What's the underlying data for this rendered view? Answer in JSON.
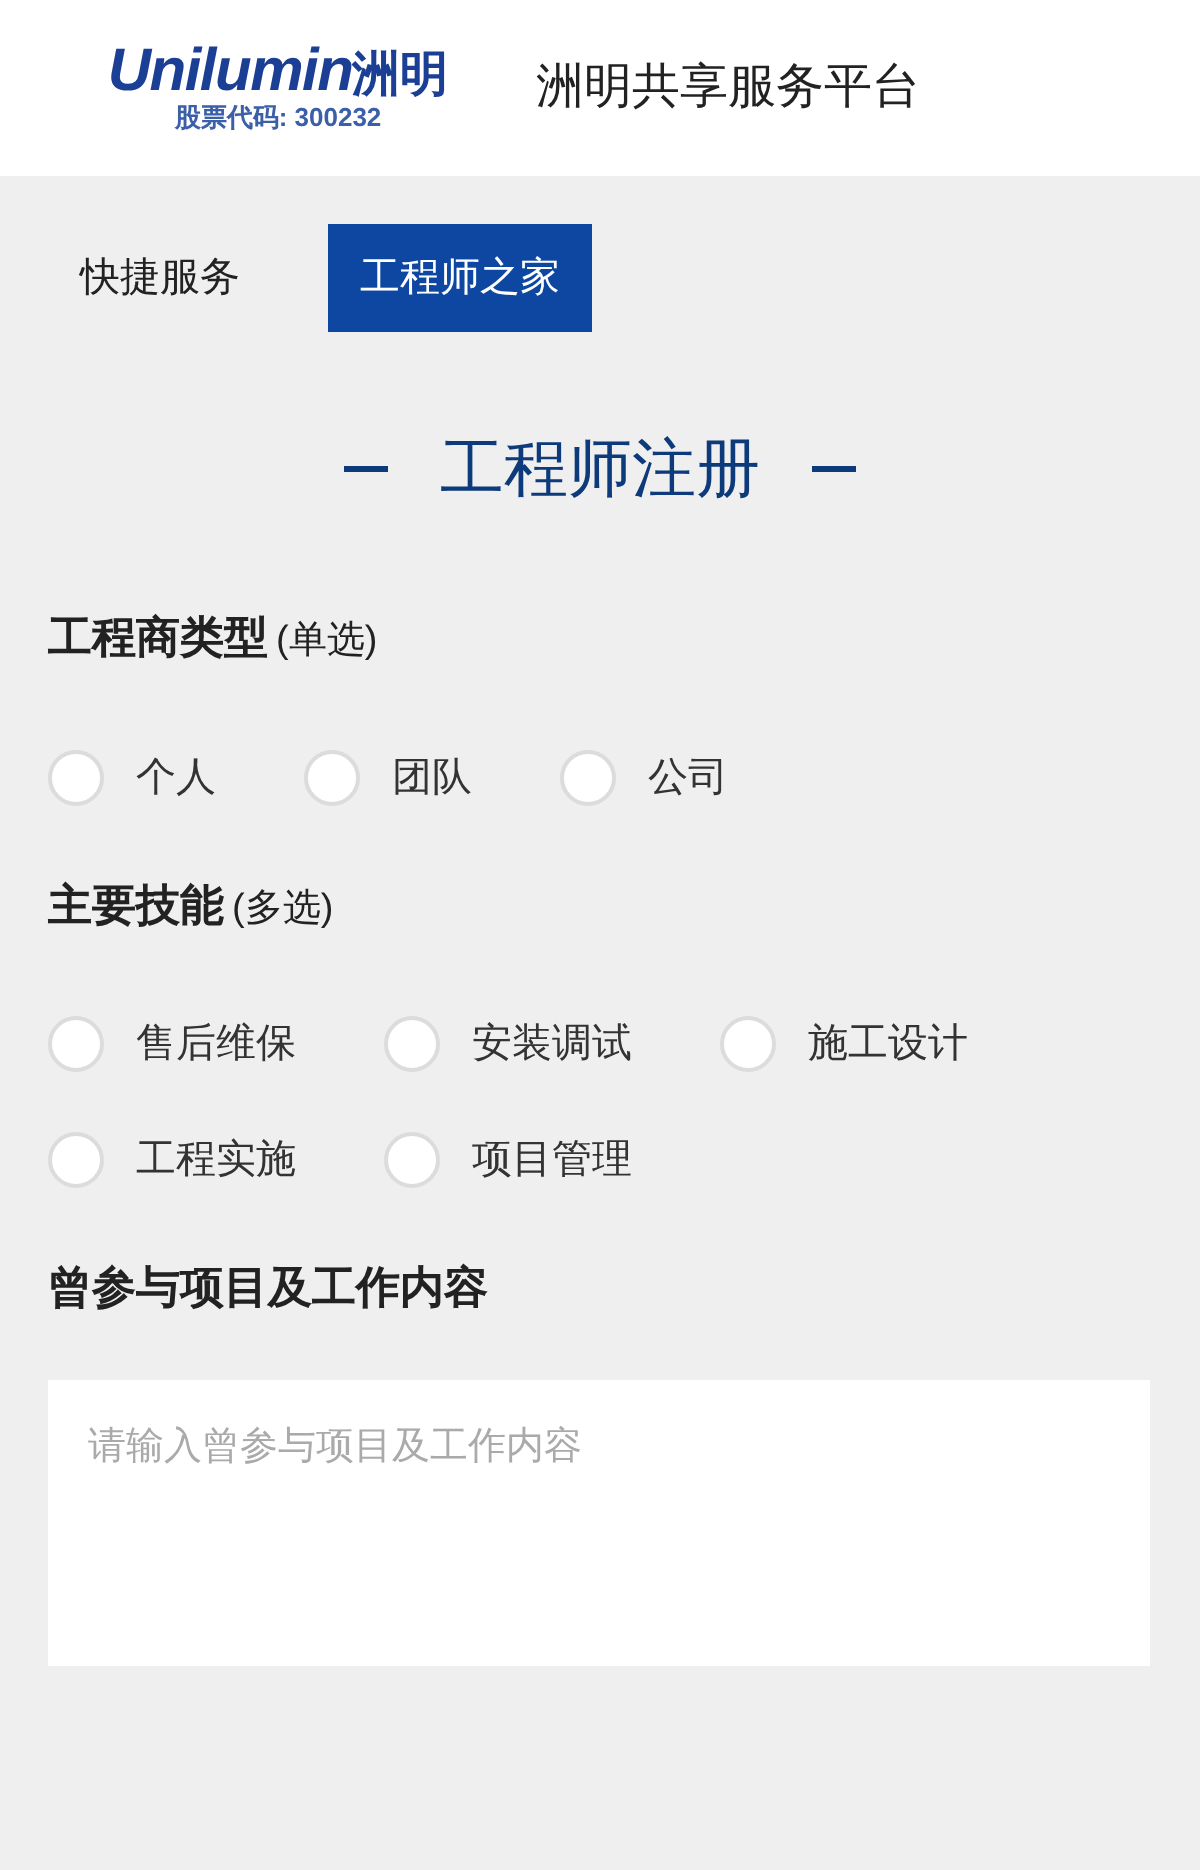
{
  "header": {
    "logo": {
      "brand": "Unilumin",
      "brand_cn": "洲明",
      "stock_code": "股票代码: 300232"
    },
    "title": "洲明共享服务平台"
  },
  "tabs": [
    {
      "label": "快捷服务",
      "selected": false
    },
    {
      "label": "工程师之家",
      "selected": true
    }
  ],
  "form_title": "工程师注册",
  "sections": [
    {
      "kind": "radio",
      "label": "工程商类型",
      "hint": "(单选)",
      "options": [
        {
          "label": "个人",
          "checked": false
        },
        {
          "label": "团队",
          "checked": false
        },
        {
          "label": "公司",
          "checked": false
        }
      ]
    },
    {
      "kind": "checkbox",
      "label": "主要技能",
      "hint": "(多选)",
      "options": [
        {
          "label": "售后维保",
          "checked": false
        },
        {
          "label": "安装调试",
          "checked": false
        },
        {
          "label": "施工设计",
          "checked": false
        },
        {
          "label": "工程实施",
          "checked": false
        },
        {
          "label": "项目管理",
          "checked": false
        }
      ]
    },
    {
      "kind": "textarea",
      "label": "曾参与项目及工作内容",
      "placeholder": "请输入曾参与项目及工作内容"
    }
  ]
}
